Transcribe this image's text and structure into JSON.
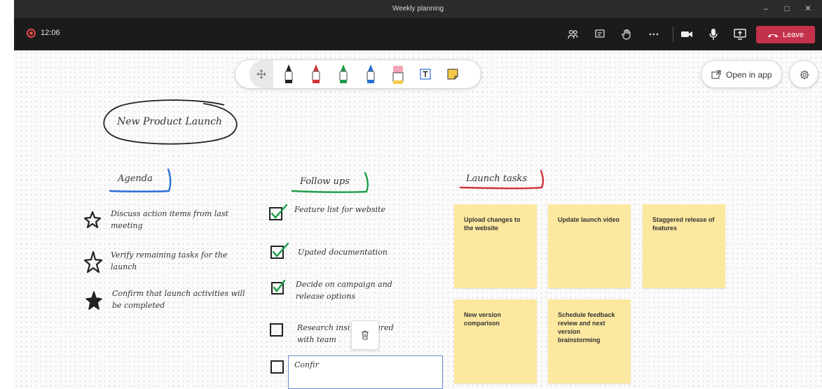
{
  "window": {
    "title": "Weekly planning"
  },
  "meeting": {
    "time": "12:06",
    "leave_label": "Leave",
    "icons": [
      "people-icon",
      "chat-icon",
      "raise-hand-icon",
      "more-icon",
      "camera-icon",
      "mic-icon",
      "share-icon"
    ]
  },
  "toolbar": {
    "tools": [
      "lasso-select-icon",
      "black-pen-icon",
      "red-pen-icon",
      "green-pen-icon",
      "blue-pen-icon",
      "highlighter-icon",
      "text-tool-icon",
      "sticky-note-icon"
    ],
    "colors": {
      "black": "#222222",
      "red": "#d13438",
      "green": "#1e9e4a",
      "blue": "#2b6fd6",
      "highlighter": "#f4a6b6",
      "note": "#f7c948"
    }
  },
  "open_in_app_label": "Open in app",
  "whiteboard": {
    "title": "New Product Launch",
    "agenda": {
      "heading": "Agenda",
      "underline_color": "#2b6fd6",
      "items": [
        {
          "line1": "Discuss action items from last",
          "line2": "meeting"
        },
        {
          "line1": "Verify remaining tasks for the",
          "line2": "launch"
        },
        {
          "line1": "Confirm that launch activities will",
          "line2": "be completed"
        }
      ]
    },
    "follow_ups": {
      "heading": "Follow ups",
      "underline_color": "#1e9e4a",
      "items": [
        {
          "line1": "Feature list for website",
          "line2": "",
          "checked": true
        },
        {
          "line1": "Upated documentation",
          "line2": "",
          "checked": true
        },
        {
          "line1": "Decide on campaign and",
          "line2": "release options",
          "checked": true
        },
        {
          "line1": "Research insi",
          "line1b": "hared",
          "line2": "with team",
          "checked": false
        }
      ],
      "editing_value": "Confir"
    },
    "launch_tasks": {
      "heading": "Launch tasks",
      "underline_color": "#d13438",
      "notes": [
        "Upload changes to the website",
        "Update launch video",
        "Staggered release of features",
        "New version comparison",
        "Schedule feedback review and next version brainstorming"
      ]
    }
  }
}
